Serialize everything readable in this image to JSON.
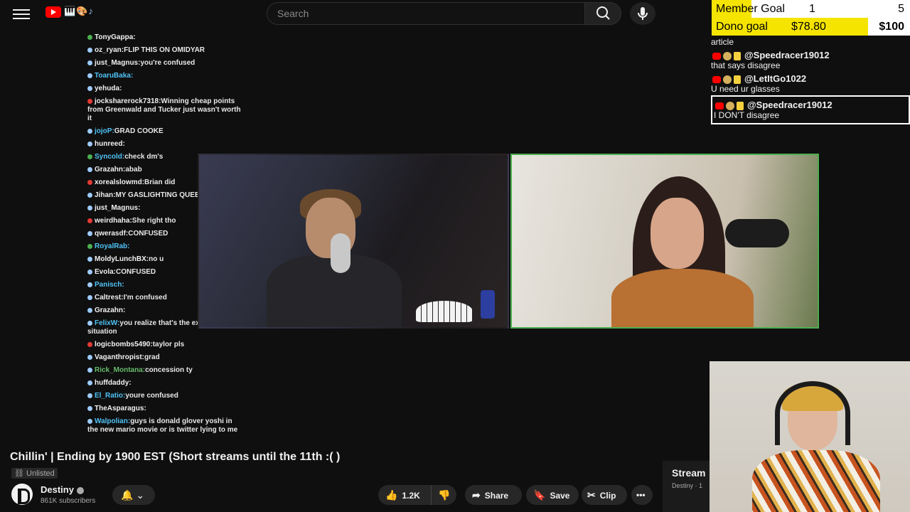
{
  "header": {
    "search_placeholder": "Search",
    "logo_icons": "🎹🎨♪"
  },
  "left_chat": [
    {
      "user": "TonyGappa:",
      "text": "",
      "color": "#f1f1f1",
      "dot": "#4caf50"
    },
    {
      "user": "oz_ryan:",
      "text": "FLIP THIS ON OMIDYAR",
      "color": "#f1f1f1",
      "dot": "#9ecbff"
    },
    {
      "user": "just_Magnus:",
      "text": "you're confused",
      "color": "#f1f1f1",
      "dot": "#9ecbff"
    },
    {
      "user": "ToaruBaka:",
      "text": "",
      "color": "#4fc3f7",
      "dot": "#9ecbff"
    },
    {
      "user": "yehuda:",
      "text": "",
      "color": "#f1f1f1",
      "dot": "#9ecbff"
    },
    {
      "user": "jocksharerock7318:",
      "text": "Winning cheap points from Greenwald and Tucker just wasn't worth it",
      "color": "#f1f1f1",
      "dot": "#e53935"
    },
    {
      "user": "jojoP:",
      "text": "GRAD COOKE",
      "color": "#4fc3f7",
      "dot": "#9ecbff"
    },
    {
      "user": "hunreed:",
      "text": "",
      "color": "#f1f1f1",
      "dot": "#9ecbff"
    },
    {
      "user": "Syncold:",
      "text": "check dm's",
      "color": "#4fc3f7",
      "dot": "#4caf50"
    },
    {
      "user": "Grazahn:",
      "text": "abab",
      "color": "#f1f1f1",
      "dot": "#9ecbff"
    },
    {
      "user": "xorealslowmd:",
      "text": "Brian did",
      "color": "#f1f1f1",
      "dot": "#e53935"
    },
    {
      "user": "Jihan:",
      "text": "MY GASLIGHTING QUEEEEEEEN",
      "color": "#f1f1f1",
      "dot": "#9ecbff"
    },
    {
      "user": "just_Magnus:",
      "text": "",
      "color": "#f1f1f1",
      "dot": "#9ecbff"
    },
    {
      "user": "weirdhaha:",
      "text": "She right tho",
      "color": "#f1f1f1",
      "dot": "#e53935"
    },
    {
      "user": "qwerasdf:",
      "text": "CONFUSED",
      "color": "#f1f1f1",
      "dot": "#9ecbff"
    },
    {
      "user": "RoyalRab:",
      "text": "",
      "color": "#4fc3f7",
      "dot": "#4caf50"
    },
    {
      "user": "MoldyLunchBX:",
      "text": "no u",
      "color": "#f1f1f1",
      "dot": "#9ecbff"
    },
    {
      "user": "Evola:",
      "text": "CONFUSED",
      "color": "#f1f1f1",
      "dot": "#9ecbff"
    },
    {
      "user": "Panisch:",
      "text": "",
      "color": "#4fc3f7",
      "dot": "#9ecbff"
    },
    {
      "user": "Caltrest:",
      "text": "I'm confused",
      "color": "#f1f1f1",
      "dot": "#9ecbff"
    },
    {
      "user": "Grazahn:",
      "text": "",
      "color": "#f1f1f1",
      "dot": "#9ecbff"
    },
    {
      "user": "FelixW:",
      "text": "you realize that's the exact same situation",
      "color": "#4fc3f7",
      "dot": "#9ecbff"
    },
    {
      "user": "logicbombs5490:",
      "text": "taylor pls",
      "color": "#f1f1f1",
      "dot": "#e53935"
    },
    {
      "user": "Vaganthropist:",
      "text": "grad",
      "color": "#f1f1f1",
      "dot": "#9ecbff"
    },
    {
      "user": "Rick_Montana:",
      "text": "concession ty",
      "color": "#66bb6a",
      "dot": "#9ecbff"
    },
    {
      "user": "huffdaddy:",
      "text": "",
      "color": "#f1f1f1",
      "dot": "#9ecbff"
    },
    {
      "user": "El_Ratio:",
      "text": "youre confused",
      "color": "#4fc3f7",
      "dot": "#9ecbff"
    },
    {
      "user": "TheAsparagus:",
      "text": "",
      "color": "#f1f1f1",
      "dot": "#9ecbff"
    },
    {
      "user": "Walpolian:",
      "text": "guys is donald glover yoshi in the new mario movie or is twitter lying to me",
      "color": "#4fc3f7",
      "dot": "#9ecbff"
    }
  ],
  "goals": {
    "member_label": "Member Goal",
    "member_current": "1",
    "member_target": "5",
    "member_progress": 0.2,
    "dono_label": "Dono goal",
    "dono_current": "$78.80",
    "dono_target": "$100",
    "dono_progress": 0.788,
    "member_color": "#f5e400",
    "dono_color": "#f5e400"
  },
  "right_chat": [
    {
      "name": "",
      "text": "article"
    },
    {
      "name": "@Speedracer19012",
      "text": "that says disagree"
    },
    {
      "name": "@LetItGo1022",
      "text": "U need ur glasses"
    },
    {
      "name": "@Speedracer19012",
      "text": "I DON'T disagree",
      "highlight": true
    }
  ],
  "video": {
    "title": "Chillin' | Ending by 1900 EST (Short streams until the 11th :( )",
    "visibility": "Unlisted",
    "channel": "Destiny",
    "subscribers": "861K subscribers",
    "likes": "1.2K",
    "share_label": "Share",
    "save_label": "Save",
    "clip_label": "Clip",
    "more_label": "•••"
  },
  "sidebar_next": {
    "title": "Stream",
    "channel": "Destiny · 1"
  }
}
